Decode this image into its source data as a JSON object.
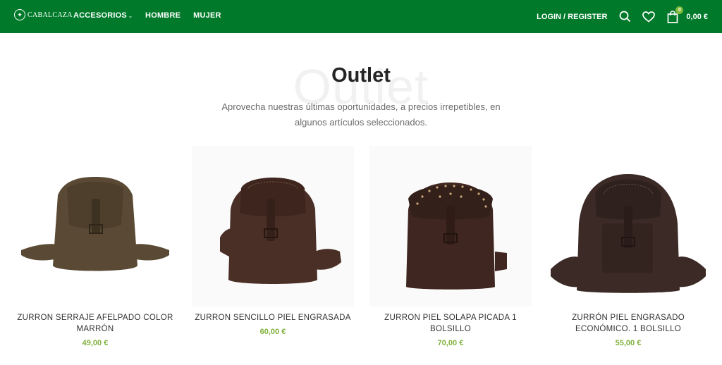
{
  "header": {
    "logo_text": "CABALCAZA",
    "nav": [
      "ACCESORIOS",
      "HOMBRE",
      "MUJER"
    ],
    "login": "LOGIN / REGISTER",
    "cart_count": "0",
    "cart_total": "0,00 €"
  },
  "hero": {
    "watermark": "Outlet",
    "title": "Outlet",
    "subtitle": "Aprovecha nuestras últimas oportunidades, a precios irrepetibles, en algunos artículos seleccionados."
  },
  "products": [
    {
      "name": "ZURRON SERRAJE AFELPADO COLOR MARRÓN",
      "price": "49,00 €",
      "color": "#5a4a35",
      "flap": "#4e3f2c"
    },
    {
      "name": "ZURRON SENCILLO PIEL ENGRASADA",
      "price": "60,00 €",
      "color": "#4a2f26",
      "flap": "#3e261e"
    },
    {
      "name": "ZURRON PIEL SOLAPA PICADA 1 BOLSILLO",
      "price": "70,00 €",
      "color": "#3f2620",
      "flap": "#34201a"
    },
    {
      "name": "ZURRÓN PIEL ENGRASADO ECONÓMICO. 1 BOLSILLO",
      "price": "55,00 €",
      "color": "#3b2a25",
      "flap": "#2f211d"
    }
  ],
  "colors": {
    "brand_green": "#007a2a",
    "price_green": "#7fb13a"
  }
}
